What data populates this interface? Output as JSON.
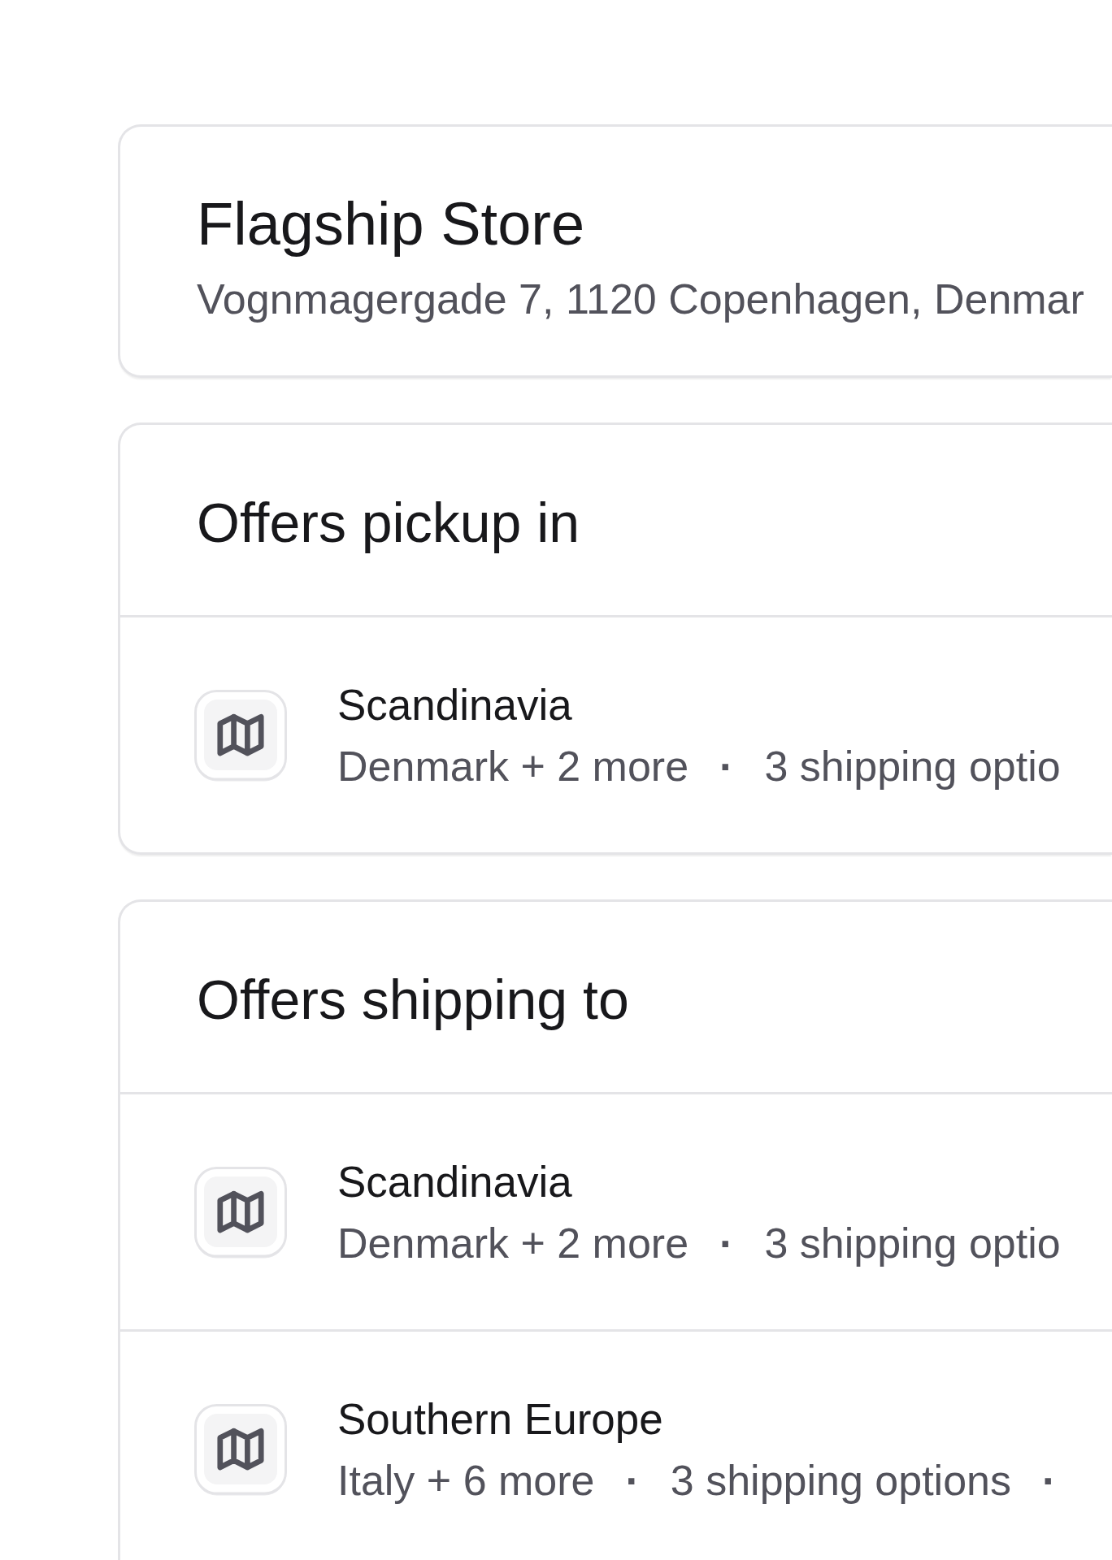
{
  "store": {
    "name": "Flagship Store",
    "address": "Vognmagergade 7, 1120 Copenhagen, Denmar"
  },
  "sections": [
    {
      "title": "Offers pickup in",
      "zones": [
        {
          "name": "Scandinavia",
          "details": [
            {
              "kind": "text",
              "text": "Denmark + 2 more"
            },
            {
              "kind": "separator",
              "text": "·"
            },
            {
              "kind": "text",
              "text": "3 shipping optio"
            }
          ]
        }
      ]
    },
    {
      "title": "Offers shipping to",
      "zones": [
        {
          "name": "Scandinavia",
          "details": [
            {
              "kind": "text",
              "text": "Denmark + 2 more"
            },
            {
              "kind": "separator",
              "text": "·"
            },
            {
              "kind": "text",
              "text": "3 shipping optio"
            }
          ]
        },
        {
          "name": "Southern Europe",
          "details": [
            {
              "kind": "text",
              "text": "Italy + 6 more"
            },
            {
              "kind": "separator",
              "text": "·"
            },
            {
              "kind": "text",
              "text": "3 shipping options"
            },
            {
              "kind": "separator",
              "text": "·"
            }
          ]
        }
      ]
    }
  ]
}
